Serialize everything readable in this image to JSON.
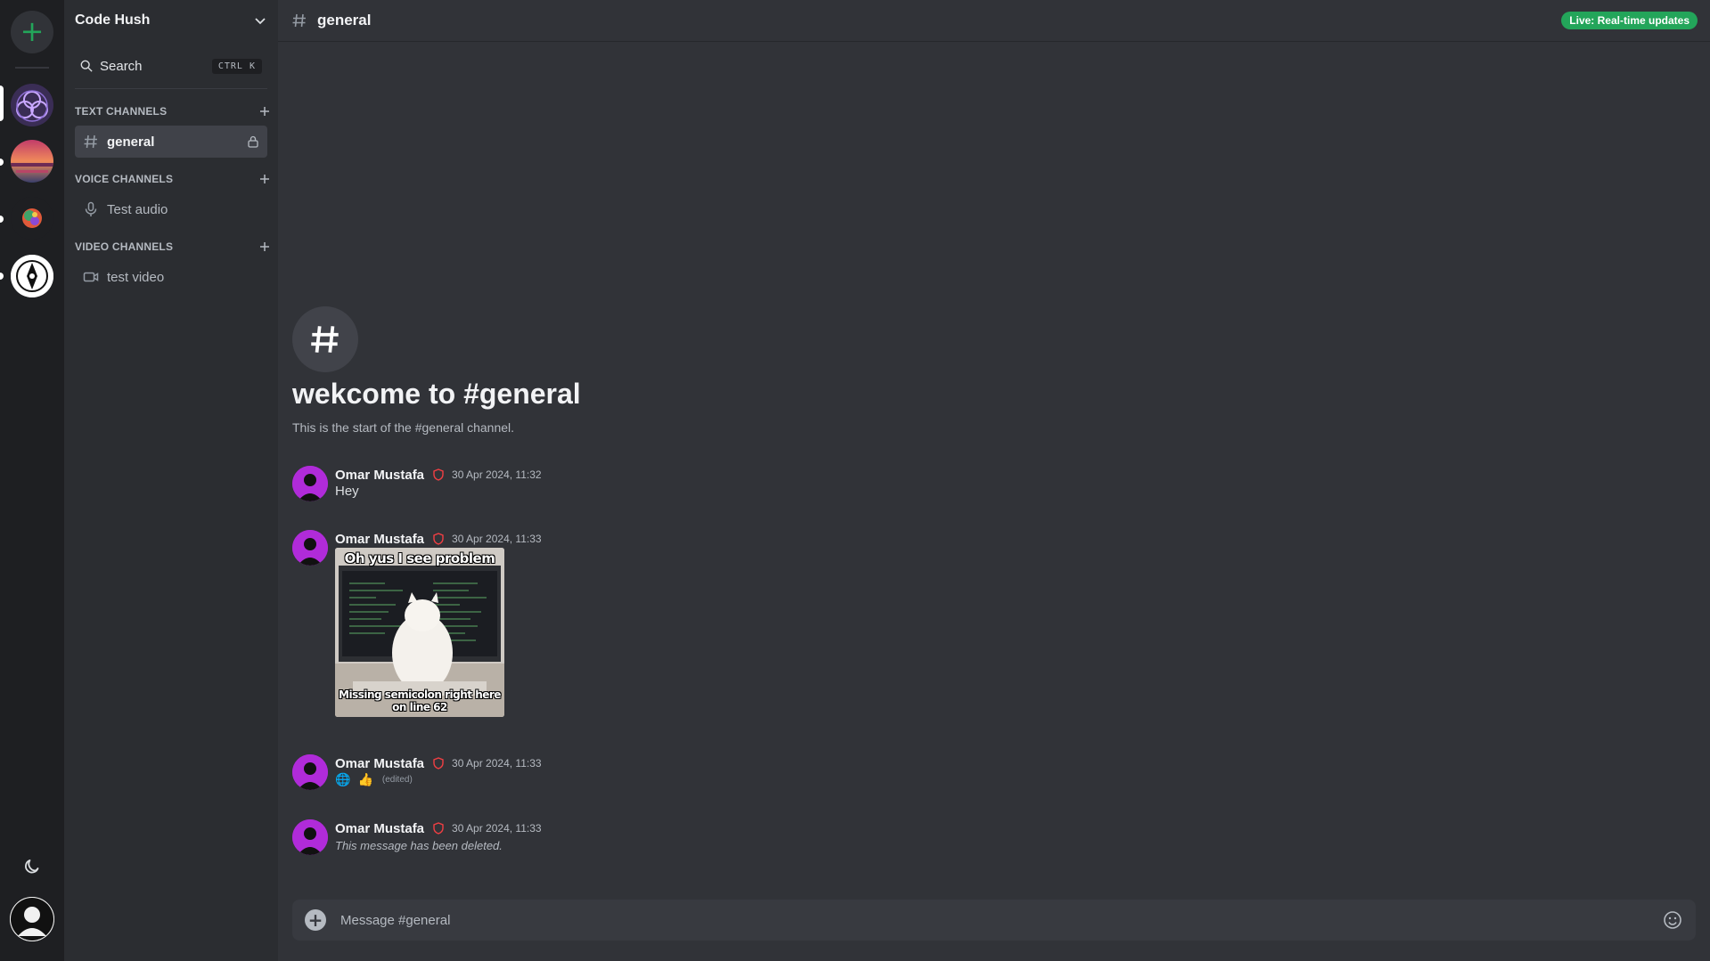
{
  "server": {
    "name": "Code Hush"
  },
  "search": {
    "label": "Search",
    "shortcut": "CTRL K"
  },
  "categories": {
    "text": {
      "label": "TEXT CHANNELS"
    },
    "voice": {
      "label": "VOICE CHANNELS"
    },
    "video": {
      "label": "VIDEO CHANNELS"
    }
  },
  "channels": {
    "text": [
      {
        "name": "general"
      }
    ],
    "voice": [
      {
        "name": "Test audio"
      }
    ],
    "video": [
      {
        "name": "test video"
      }
    ]
  },
  "header": {
    "channel": "general",
    "live_badge": "Live: Real-time updates"
  },
  "welcome": {
    "title": "wekcome to #general",
    "subtitle": "This is the start of the #general channel."
  },
  "messages": [
    {
      "author": "Omar Mustafa",
      "time": "30 Apr 2024, 11:32",
      "text": "Hey"
    },
    {
      "author": "Omar Mustafa",
      "time": "30 Apr 2024, 11:33",
      "image": {
        "top_caption": "Oh yus I see problem",
        "bottom_caption": "Missing semicolon right here on line 62"
      }
    },
    {
      "author": "Omar Mustafa",
      "time": "30 Apr 2024, 11:33",
      "emojis": [
        "🌐",
        "👍"
      ],
      "edited": "(edited)"
    },
    {
      "author": "Omar Mustafa",
      "time": "30 Apr 2024, 11:33",
      "text": "This message has been deleted."
    }
  ],
  "composer": {
    "placeholder": "Message #general"
  },
  "colors": {
    "accent_green": "#23a55a",
    "admin_shield": "#f23f43",
    "avatar_purple": "#b02bd9"
  },
  "icons": [
    "plus-icon",
    "moon-icon",
    "chevron-down-icon",
    "search-icon",
    "hash-icon",
    "lock-icon",
    "microphone-icon",
    "video-camera-icon",
    "shield-icon",
    "emoji-icon"
  ]
}
